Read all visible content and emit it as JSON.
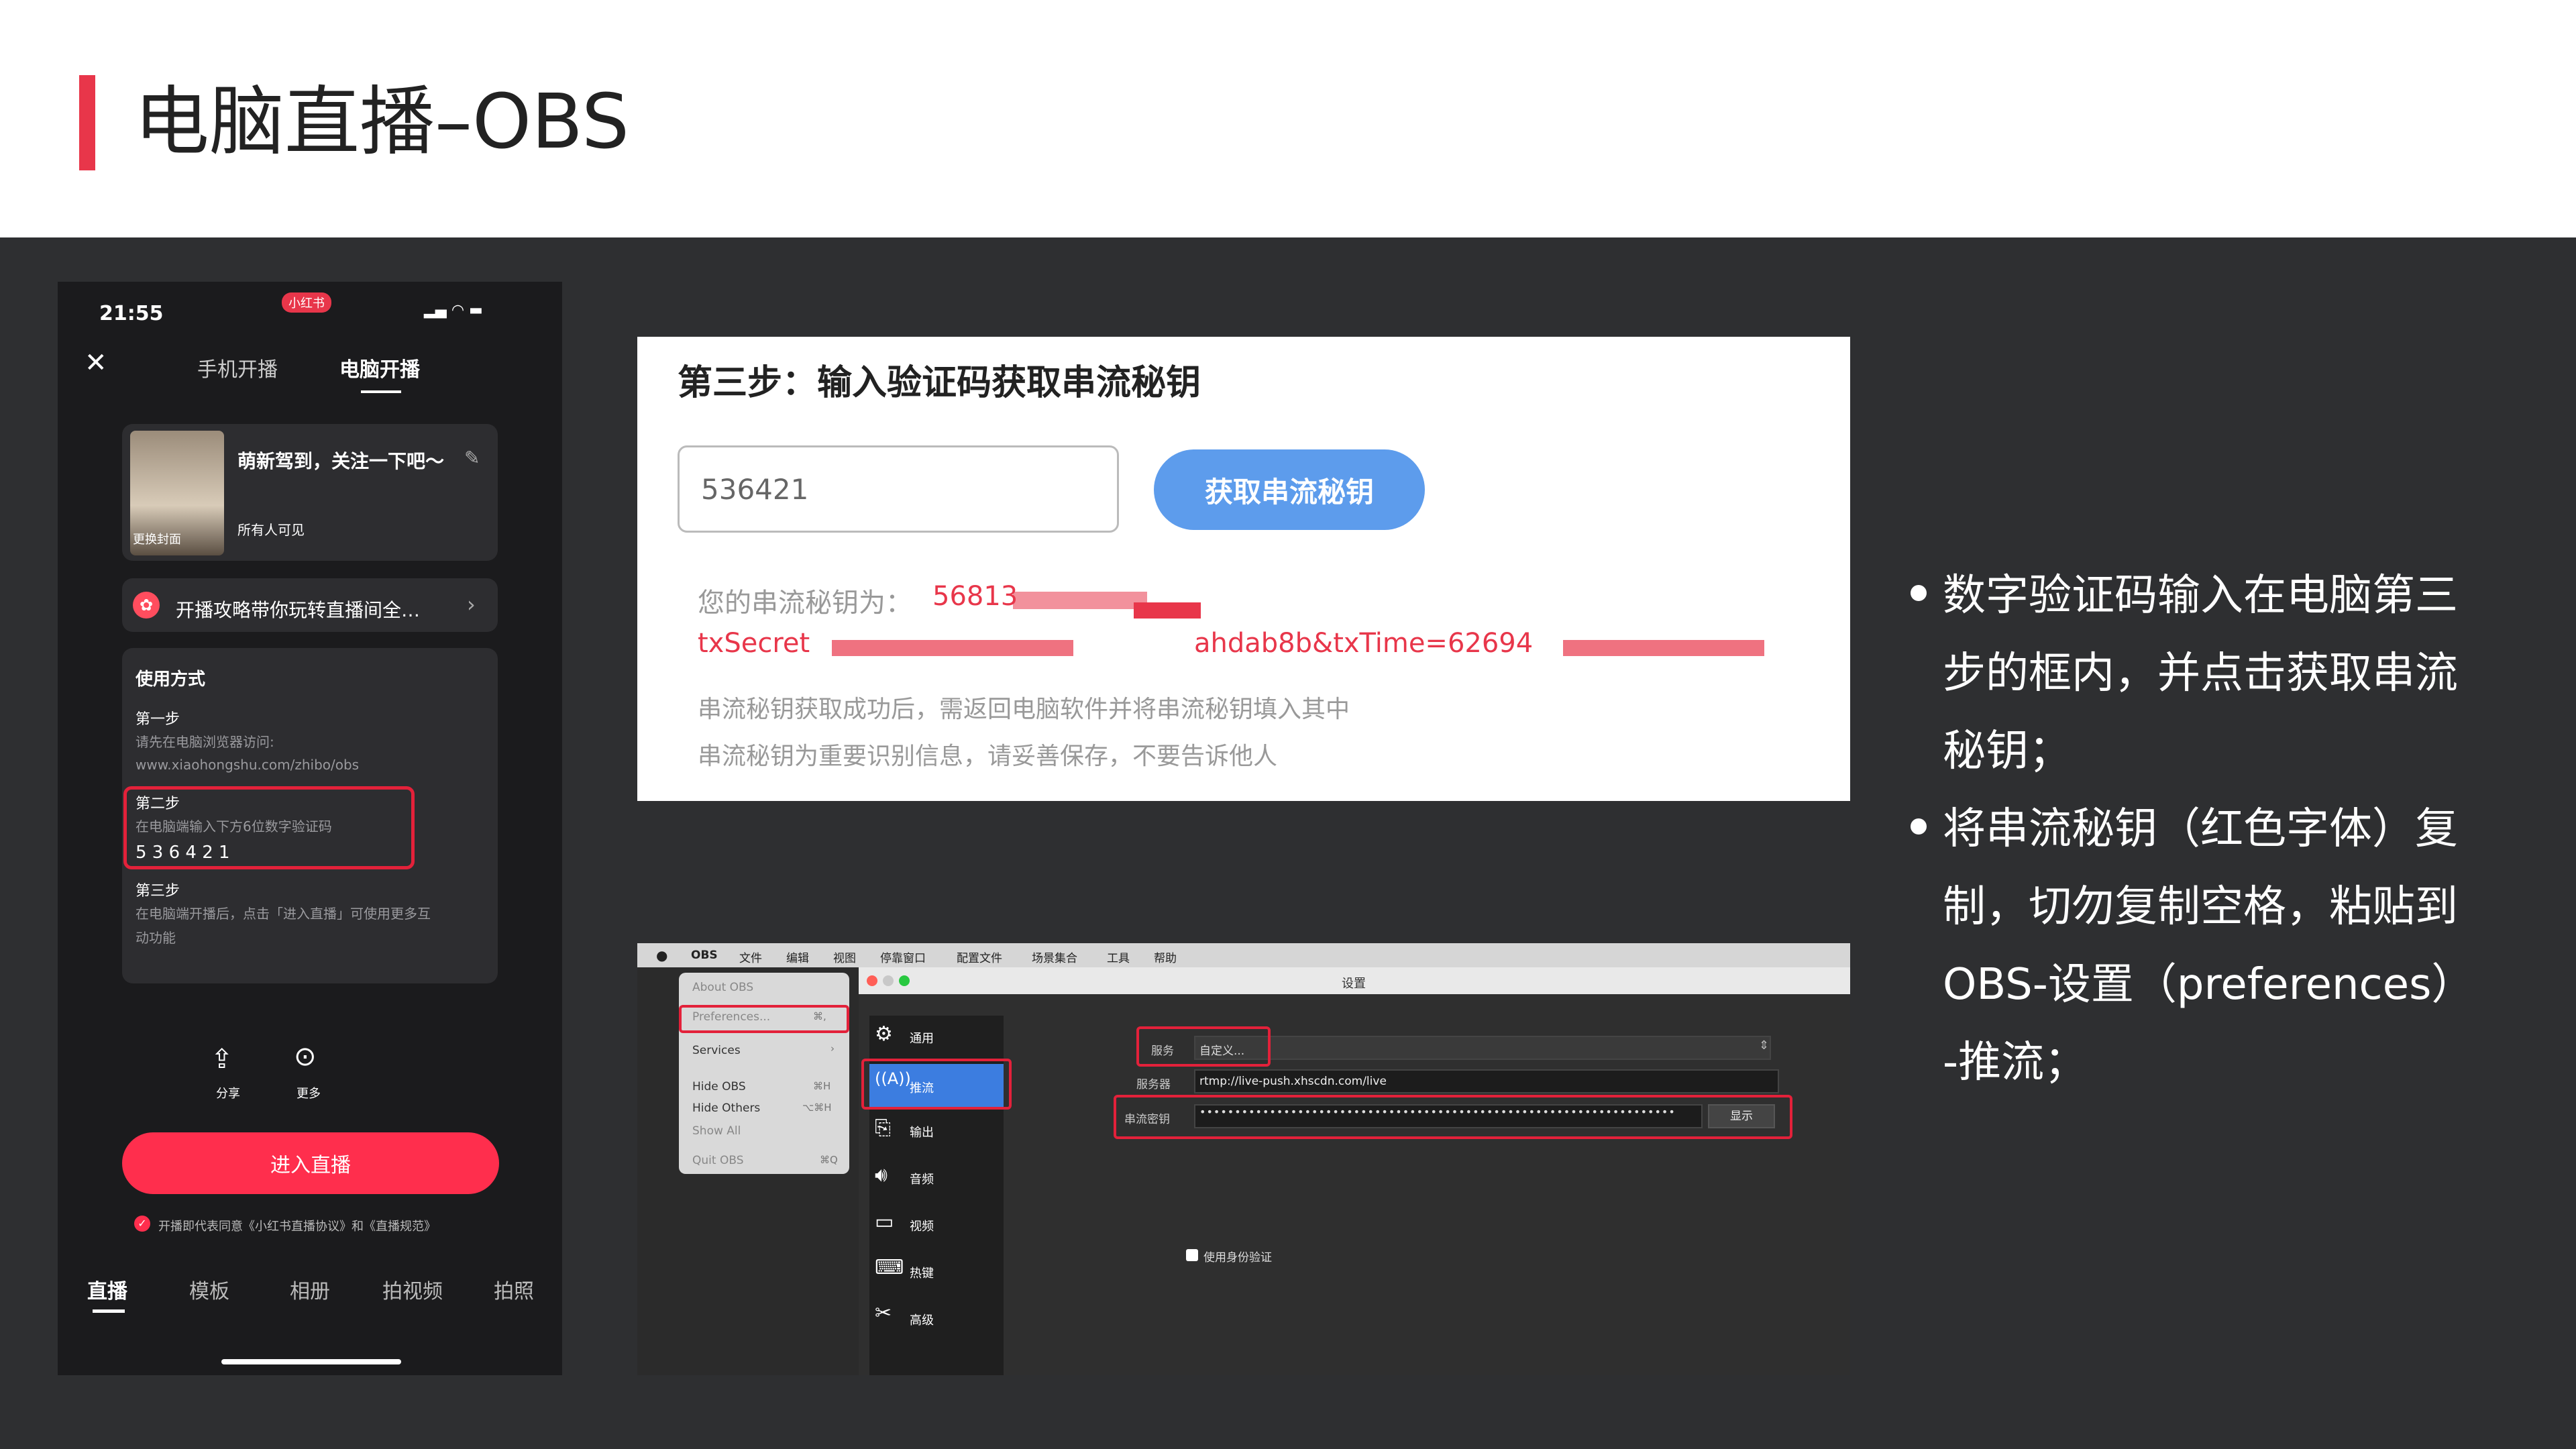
{
  "header": {
    "title": "电脑直播–OBS"
  },
  "phone": {
    "status_time": "21:55",
    "app_badge": "小红书",
    "tabs": [
      "手机开播",
      "电脑开播"
    ],
    "cover_title": "萌新驾到，关注一下吧～",
    "visibility": "所有人可见",
    "change_cover": "更换封面",
    "guide_text": "开播攻略带你玩转直播间全…",
    "usage_title": "使用方式",
    "step1_title": "第一步",
    "step1_desc": "请先在电脑浏览器访问:",
    "step1_url": "www.xiaohongshu.com/zhibo/obs",
    "step2_title": "第二步",
    "step2_desc": "在电脑端输入下方6位数字验证码",
    "step2_code": "5 3 6 4 2 1",
    "step3_title": "第三步",
    "step3_desc1": "在电脑端开播后，点击「进入直播」可使用更多互",
    "step3_desc2": "动功能",
    "share_label": "分享",
    "more_label": "更多",
    "enter_button": "进入直播",
    "agreement": "开播即代表同意《小红书直播协议》和《直播规范》",
    "bottom_tabs": [
      "直播",
      "模板",
      "相册",
      "拍视频",
      "拍照"
    ]
  },
  "step3_card": {
    "title": "第三步：输入验证码获取串流秘钥",
    "code_value": "536421",
    "get_key_button": "获取串流秘钥",
    "key_label": "您的串流秘钥为：",
    "key_part1": "56813",
    "key_part2": "txSecret",
    "key_part3": "ahdab8b&txTime=62694",
    "note1": "串流秘钥获取成功后，需返回电脑软件并将串流秘钥填入其中",
    "note2": "串流秘钥为重要识别信息，请妥善保存，不要告诉他人"
  },
  "obs": {
    "menubar": [
      "OBS",
      "文件",
      "编辑",
      "视图",
      "停靠窗口",
      "配置文件",
      "场景集合",
      "工具",
      "帮助"
    ],
    "menu_items": [
      {
        "label": "About OBS",
        "key": ""
      },
      {
        "label": "Preferences...",
        "key": "⌘,"
      },
      {
        "label": "Services",
        "key": "›"
      },
      {
        "label": "Hide OBS",
        "key": "⌘H"
      },
      {
        "label": "Hide Others",
        "key": "⌥⌘H"
      },
      {
        "label": "Show All",
        "key": ""
      },
      {
        "label": "Quit OBS",
        "key": "⌘Q"
      }
    ],
    "settings_title": "设置",
    "sidebar": [
      "通用",
      "推流",
      "输出",
      "音频",
      "视频",
      "热键",
      "高级"
    ],
    "service_label": "服务",
    "service_value": "自定义...",
    "server_label": "服务器",
    "server_value": "rtmp://live-push.xhscdn.com/live",
    "key_label": "串流密钥",
    "key_dots": "••••••••••••••••••••••••••••••••••••••••••••••••••••••••••••••••••••",
    "show_button": "显示",
    "auth_checkbox": "使用身份验证"
  },
  "bullets": [
    {
      "lines": [
        "数字验证码输入在电脑第三",
        "步的框内，并点击获取串流",
        "秘钥；"
      ]
    },
    {
      "lines": [
        "将串流秘钥（红色字体）复",
        "制，切勿复制空格，粘贴到",
        "OBS-设置（preferences）",
        "-推流；"
      ]
    }
  ],
  "colors": {
    "accent": "#e8364a",
    "button_blue": "#5d9cec",
    "stage_bg": "#2e2f31"
  }
}
